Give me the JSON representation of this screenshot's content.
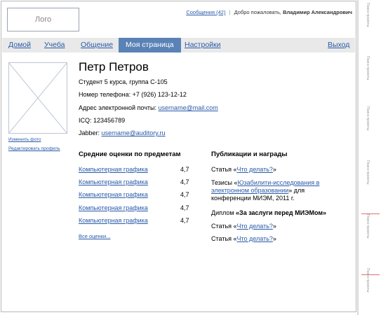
{
  "header": {
    "logo": "Лого",
    "messages_link": "Сообщения (42)",
    "separator": "|",
    "greeting": "Добро пожаловать,",
    "user_name": "Владимир Александрович"
  },
  "nav": {
    "items": [
      "Домой",
      "Учеба",
      "Общение",
      "Моя страница",
      "Настройки"
    ],
    "logout": "Выход"
  },
  "profile": {
    "name": "Петр Петров",
    "student": "Студент 5 курса, группа С-105",
    "phone_label": "Номер телефона:",
    "phone": "+7 (926) 123-12-12",
    "email_label": "Адрес электронной почты:",
    "email": "username@mail.com",
    "icq_label": "ICQ:",
    "icq": "123456789",
    "jabber_label": "Jabber:",
    "jabber": "username@auditory.ru",
    "change_photo": "Изменить фото",
    "edit_profile": "Редактировать профиль"
  },
  "grades": {
    "title": "Средние оценки по предметам",
    "rows": [
      {
        "subject": "Компьютерная графика",
        "value": "4,7"
      },
      {
        "subject": "Компьютерная графика",
        "value": "4,7"
      },
      {
        "subject": "Компьютерная графика",
        "value": "4,7"
      },
      {
        "subject": "Компьютерная графика",
        "value": "4,7"
      },
      {
        "subject": "Компьютерная графика",
        "value": "4,7"
      }
    ],
    "all_link": "Все оценки..."
  },
  "publications": {
    "title": "Публикации и награды",
    "p1_prefix": "Статья «",
    "p1_link": "Что делать?",
    "p1_suffix": "»",
    "p2_prefix": "Тезисы «",
    "p2_link_a": "Юзабилити-исследования в",
    "p2_link_b": "электронном образовании",
    "p2_suffix": "» для",
    "p2_line3": "конференции МИЭМ, 2011 г.",
    "p3_prefix": "Диплом ",
    "p3_bold": "«За заслуги перед МИЭМом»",
    "p4_prefix": "Статья «",
    "p4_link": "Что делать?",
    "p4_suffix": "»",
    "p5_prefix": "Статья «",
    "p5_link": "Что делать?",
    "p5_suffix": "»"
  },
  "sidebar_labels": [
    "Поиск проекты",
    "Поиск проекты",
    "Поиск проекты",
    "Поиск проекты",
    "Поиск проекты",
    "Поиск проекты"
  ]
}
